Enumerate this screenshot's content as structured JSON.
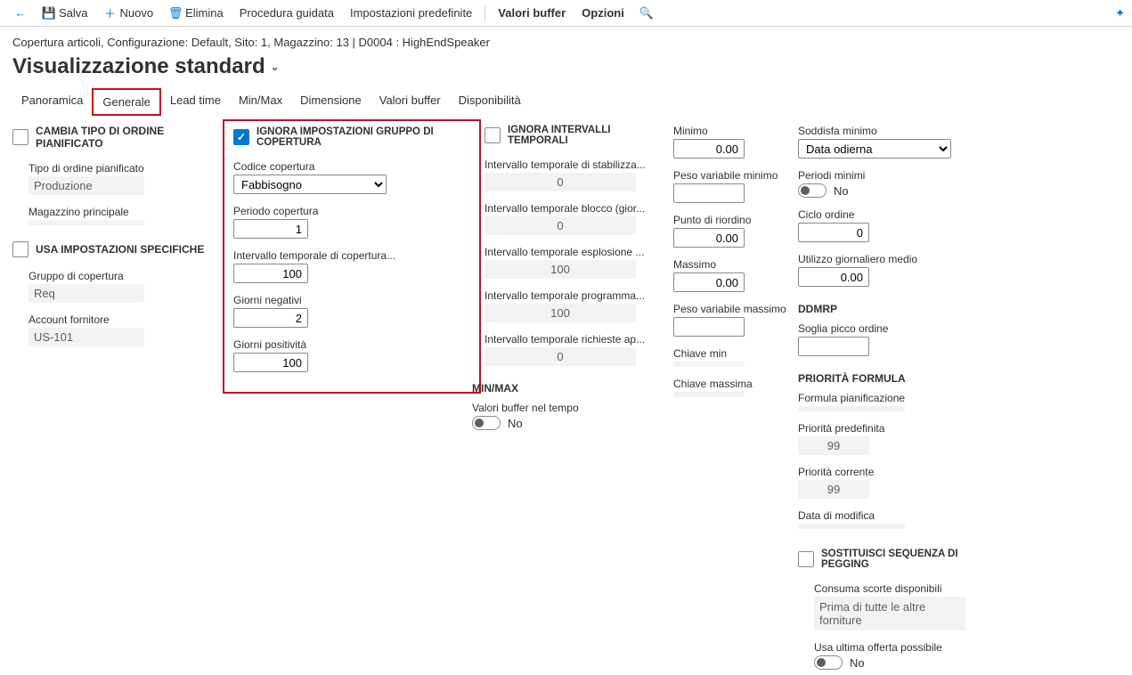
{
  "toolbar": {
    "save": "Salva",
    "new": "Nuovo",
    "delete": "Elimina",
    "wizard": "Procedura guidata",
    "defaults": "Impostazioni predefinite",
    "buffer": "Valori buffer",
    "options": "Opzioni"
  },
  "breadcrumb": "Copertura articoli, Configurazione: Default, Sito: 1, Magazzino: 13   |   D0004 : HighEndSpeaker",
  "page_title": "Visualizzazione standard",
  "tabs": [
    "Panoramica",
    "Generale",
    "Lead time",
    "Min/Max",
    "Dimensione",
    "Valori buffer",
    "Disponibilità"
  ],
  "col1": {
    "h1": "CAMBIA TIPO DI ORDINE PIANIFICATO",
    "l1": "Tipo di ordine pianificato",
    "v1": "Produzione",
    "l2": "Magazzino principale",
    "v2": "",
    "h2": "USA IMPOSTAZIONI SPECIFICHE",
    "l3": "Gruppo di copertura",
    "v3": "Req",
    "l4": "Account fornitore",
    "v4": "US-101"
  },
  "col2": {
    "h": "IGNORA IMPOSTAZIONI GRUPPO DI COPERTURA",
    "l1": "Codice copertura",
    "v1": "Fabbisogno",
    "l2": "Periodo copertura",
    "v2": "1",
    "l3": "Intervallo temporale di copertura...",
    "v3": "100",
    "l4": "Giorni negativi",
    "v4": "2",
    "l5": "Giorni positività",
    "v5": "100"
  },
  "col3": {
    "h": "IGNORA INTERVALLI TEMPORALI",
    "l1": "Intervallo temporale di stabilizza...",
    "v1": "0",
    "l2": "Intervallo temporale blocco (gior...",
    "v2": "0",
    "l3": "Intervallo temporale esplosione ...",
    "v3": "100",
    "l4": "Intervallo temporale programma...",
    "v4": "100",
    "l5": "Intervallo temporale richieste ap...",
    "v5": "0",
    "h2": "MIN/MAX",
    "l6": "Valori buffer nel tempo",
    "tog": "No"
  },
  "col4": {
    "l1": "Minimo",
    "v1": "0.00",
    "l2": "Peso variabile minimo",
    "v2": "",
    "l3": "Punto di riordino",
    "v3": "0.00",
    "l4": "Massimo",
    "v4": "0.00",
    "l5": "Peso variabile massimo",
    "v5": "",
    "l6": "Chiave min",
    "v6": "",
    "l7": "Chiave massima",
    "v7": ""
  },
  "col5": {
    "l1": "Soddisfa minimo",
    "v1": "Data odierna",
    "l2": "Periodi minimi",
    "tog2": "No",
    "l3": "Ciclo ordine",
    "v3": "0",
    "l4": "Utilizzo giornaliero medio",
    "v4": "0.00",
    "h1": "DDMRP",
    "l5": "Soglia picco ordine",
    "v5": "",
    "h2": "PRIORITÀ FORMULA",
    "l6": "Formula pianificazione",
    "v6": "",
    "l7": "Priorità predefinita",
    "v7": "99",
    "l8": "Priorità corrente",
    "v8": "99",
    "l9": "Data di modifica",
    "v9": "",
    "h3": "SOSTITUISCI SEQUENZA DI PEGGING",
    "l10": "Consuma scorte disponibili",
    "v10": "Prima di tutte le altre forniture",
    "l11": "Usa ultima offerta possibile",
    "tog11": "No"
  }
}
